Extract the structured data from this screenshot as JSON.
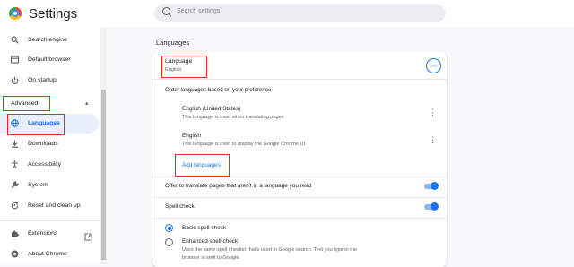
{
  "app": {
    "title": "Settings"
  },
  "search": {
    "placeholder": "Search settings"
  },
  "sidebar": {
    "items": [
      {
        "label": "Search engine",
        "icon": "search-icon"
      },
      {
        "label": "Default browser",
        "icon": "browser-icon"
      },
      {
        "label": "On startup",
        "icon": "power-icon"
      }
    ],
    "advanced": {
      "label": "Advanced",
      "chevron": "chevron-up-icon"
    },
    "advanced_items": [
      {
        "label": "Languages",
        "icon": "globe-icon",
        "active": true
      },
      {
        "label": "Downloads",
        "icon": "download-icon"
      },
      {
        "label": "Accessibility",
        "icon": "accessibility-icon"
      },
      {
        "label": "System",
        "icon": "wrench-icon"
      },
      {
        "label": "Reset and clean up",
        "icon": "reset-icon"
      }
    ],
    "footer_items": [
      {
        "label": "Extensions",
        "icon": "puzzle-icon",
        "trailing_icon": "open-external-icon"
      },
      {
        "label": "About Chrome",
        "icon": "chrome-icon"
      }
    ]
  },
  "main": {
    "section_title": "Languages",
    "language": {
      "title": "Language",
      "subtitle": "English",
      "order_label": "Order languages based on your preference",
      "entries": [
        {
          "name": "English (United States)",
          "description": "This language is used when translating pages"
        },
        {
          "name": "English",
          "description": "This language is used to display the Google Chrome UI"
        }
      ],
      "add_label": "Add languages",
      "offer_translate": {
        "label": "Offer to translate pages that aren't in a language you read",
        "enabled": true
      }
    },
    "spell_check": {
      "label": "Spell check",
      "enabled": true,
      "options": [
        {
          "label": "Basic spell check",
          "selected": true,
          "description": ""
        },
        {
          "label": "Enhanced spell check",
          "selected": false,
          "description_line1": "Uses the same spell checker that's used in Google search. Text you type in the",
          "description_line2": "browser is sent to Google."
        }
      ]
    }
  },
  "colors": {
    "accent": "#1a73e8",
    "highlight": "#d93025",
    "active_bg": "#e8f0fe"
  }
}
